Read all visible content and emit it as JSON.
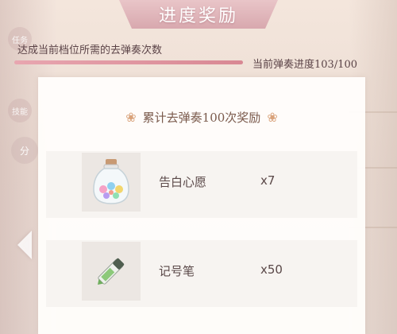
{
  "header": {
    "title": "进度奖励"
  },
  "side": {
    "badge1": "任务",
    "badge2": "技能",
    "share": "分"
  },
  "progress": {
    "description": "达成当前档位所需的去弹奏次数",
    "label": "当前弹奏进度103/100",
    "fraction": 1.0
  },
  "panel": {
    "title": "累计去弹奏100次奖励",
    "rewards": [
      {
        "name": "告白心愿",
        "qty": "x7",
        "icon": "wish-bottle-icon"
      },
      {
        "name": "记号笔",
        "qty": "x50",
        "icon": "marker-pen-icon"
      }
    ]
  },
  "colors": {
    "accent": "#d88893",
    "panel_bg": "#fffdfb",
    "text": "#5b4347"
  }
}
